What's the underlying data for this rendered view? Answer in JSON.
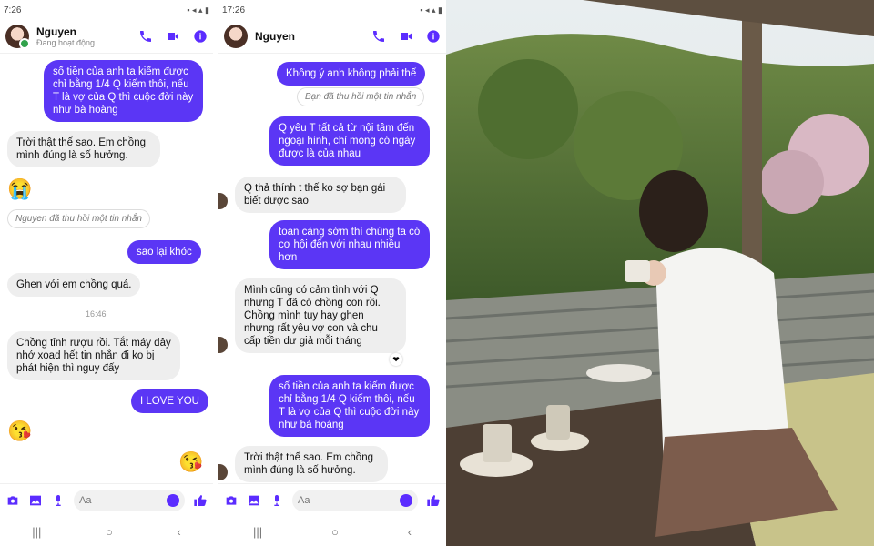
{
  "left": {
    "status_time": "7:26",
    "contact_name": "Nguyen",
    "contact_status": "Đang hoạt động",
    "messages": [
      "số tiền của anh ta kiếm được chỉ bằng 1/4 Q kiếm thôi, nếu T là vợ của Q thì cuộc đời này như bà hoàng",
      "Trời thật thế sao. Em chồng mình đúng là số hưởng.",
      "Nguyen đã thu hồi một tin nhắn",
      "sao lại khóc",
      "Ghen với em chồng quá.",
      "16:46",
      "Chồng tỉnh rượu rồi. Tắt máy đây nhớ xoad hết tin nhắn đi ko bị phát hiện thì nguy đấy",
      "I LOVE YOU"
    ],
    "emoji_cry": "😭",
    "emoji_kiss": "😘",
    "emoji_kiss2": "😘",
    "composer_placeholder": "Aa"
  },
  "right": {
    "status_time": "17:26",
    "contact_name": "Nguyen",
    "messages": [
      "Không ý anh không phải thế",
      "Bạn đã thu hồi một tin nhắn",
      "Q yêu T tất cả từ nội tâm đến ngoại hình, chỉ mong có ngày được là của nhau",
      "Q thả thính t thế ko sợ bạn gái biết được sao",
      "toan càng sớm thì chúng ta có cơ hội đến với nhau nhiều hơn",
      "Mình cũng có cảm tình với Q nhưng T đã có chồng con rồi. Chồng mình tuy hay ghen nhưng rất yêu vợ con và chu cấp tiền dư giả mỗi tháng",
      "số tiền của anh ta kiếm được chỉ bằng 1/4 Q kiếm thôi, nếu T là vợ của Q thì cuộc đời này như bà hoàng",
      "Trời thật thế sao. Em chồng mình đúng là số hưởng."
    ],
    "heart": "❤",
    "composer_placeholder": "Aa"
  },
  "navbar": [
    "|||",
    "○",
    "‹"
  ],
  "colors": {
    "accent": "#5b36f5",
    "bubble_other": "#eeeeee"
  }
}
